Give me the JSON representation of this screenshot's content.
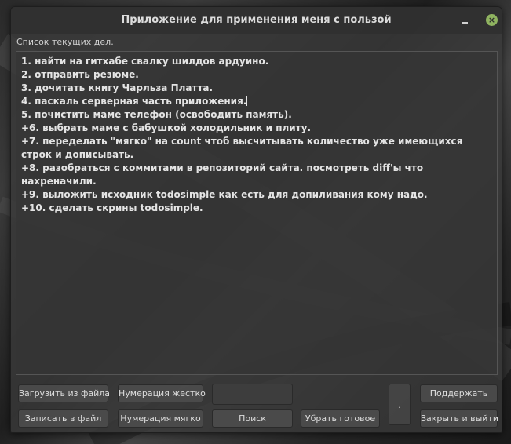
{
  "window": {
    "title": "Приложение для применения меня с пользой",
    "close_glyph": "×",
    "close_color": "#8fb360"
  },
  "list_label": "Список текущих дел.",
  "todo_lines": [
    "1. найти на гитхабе свалку шилдов ардуино.",
    "2. отправить резюме.",
    "3. дочитать книгу Чарльза Платта.",
    "4. паскаль серверная часть приложения.",
    "5. почистить маме телефон (освободить память).",
    "+6. выбрать маме с бабушкой холодильник и плиту.",
    "+7. переделать \"мягко\" на count чтоб высчитывать количество уже имеющихся строк и дописывать.",
    "+8. разобраться с коммитами в репозиторий сайта. посмотреть diff'ы что нахреначили.",
    "+9. выложить исходник todosimple как есть для допиливания кому надо.",
    "+10. сделать скрины todosimple."
  ],
  "buttons": {
    "load_from_file": "Загрузить из файла",
    "numbering_hard": "Нумерация жестко",
    "support": "Поддержать",
    "write_to_file": "Записать в файл",
    "numbering_soft": "Нумерация мягко",
    "search": "Поиск",
    "remove_done": "Убрать готовое",
    "close_and_exit": "Закрыть и выйти",
    "dot": "."
  }
}
